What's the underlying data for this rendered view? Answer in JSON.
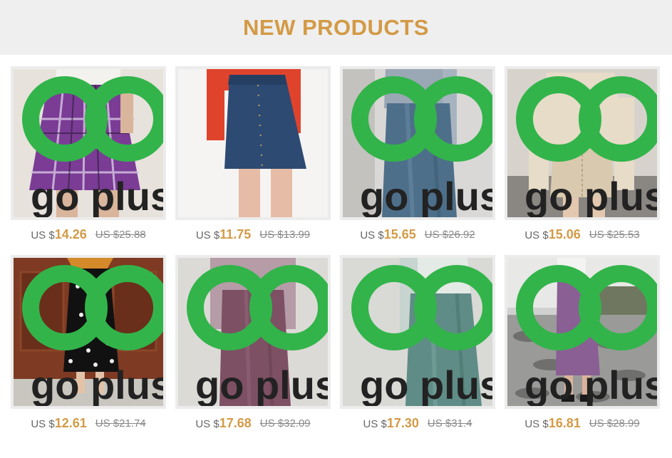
{
  "header": {
    "title": "NEW PRODUCTS"
  },
  "logo": {
    "mark": "GO",
    "text": "go plus",
    "color": "#32b44a"
  },
  "colors": {
    "accent": "#d39a46",
    "muted": "#888888",
    "header_bg": "#efefef"
  },
  "products": [
    {
      "currency": "US $",
      "price": "14.26",
      "old_price": "US $25.88",
      "has_logo": true,
      "item": "purple plaid pleated mini skirt"
    },
    {
      "currency": "US $",
      "price": "11.75",
      "old_price": "US $13.99",
      "has_logo": false,
      "item": "denim button front mini skirt"
    },
    {
      "currency": "US $",
      "price": "15.65",
      "old_price": "US $26.92",
      "has_logo": true,
      "item": "blue satin midi skirt"
    },
    {
      "currency": "US $",
      "price": "15.06",
      "old_price": "US $25.53",
      "has_logo": true,
      "item": "lace-up bodycon mini skirt"
    },
    {
      "currency": "US $",
      "price": "12.61",
      "old_price": "US $21.74",
      "has_logo": true,
      "item": "black floral midi skirt"
    },
    {
      "currency": "US $",
      "price": "17.68",
      "old_price": "US $32.09",
      "has_logo": true,
      "item": "mauve satin midi skirt"
    },
    {
      "currency": "US $",
      "price": "17.30",
      "old_price": "US $31.4",
      "has_logo": true,
      "item": "green satin midi skirt"
    },
    {
      "currency": "US $",
      "price": "16.81",
      "old_price": "US $28.99",
      "has_logo": true,
      "item": "purple knit midi skirt"
    }
  ]
}
